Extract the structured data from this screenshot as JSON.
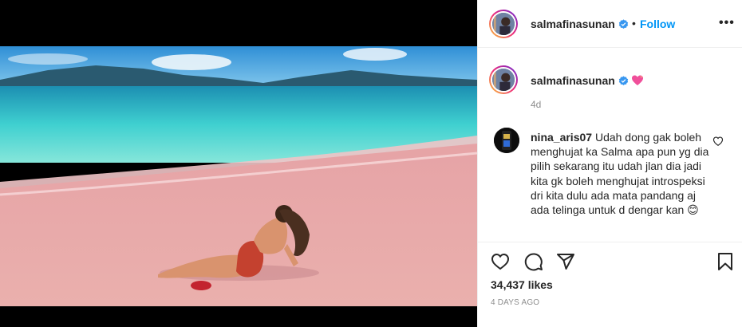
{
  "post": {
    "username": "salmafinasunan",
    "follow_label": "Follow",
    "separator": "•",
    "more_label": "•••",
    "caption_time": "4d",
    "likes": "34,437 likes",
    "date": "4 DAYS AGO"
  },
  "comment": {
    "username": "nina_aris07",
    "text": "Udah dong gak boleh menghujat ka Salma apa pun yg dia pilih sekarang itu udah jlan dia jadi kita gk boleh menghujat introspeksi dri kita dulu ada mata pandang aj ada telinga untuk d dengar kan",
    "emoji": "😊"
  },
  "icons": {
    "verified": "verified-badge-icon",
    "caption_emoji": "sparkling-heart-icon",
    "like": "heart-outline-icon",
    "comment": "comment-bubble-icon",
    "share": "paper-plane-icon",
    "save": "bookmark-icon"
  },
  "colors": {
    "accent": "#0095f6",
    "verified": "#3897f0",
    "muted": "#8e8e8e",
    "sand": "#e8a6a6",
    "sea": "#3fd0d0"
  }
}
